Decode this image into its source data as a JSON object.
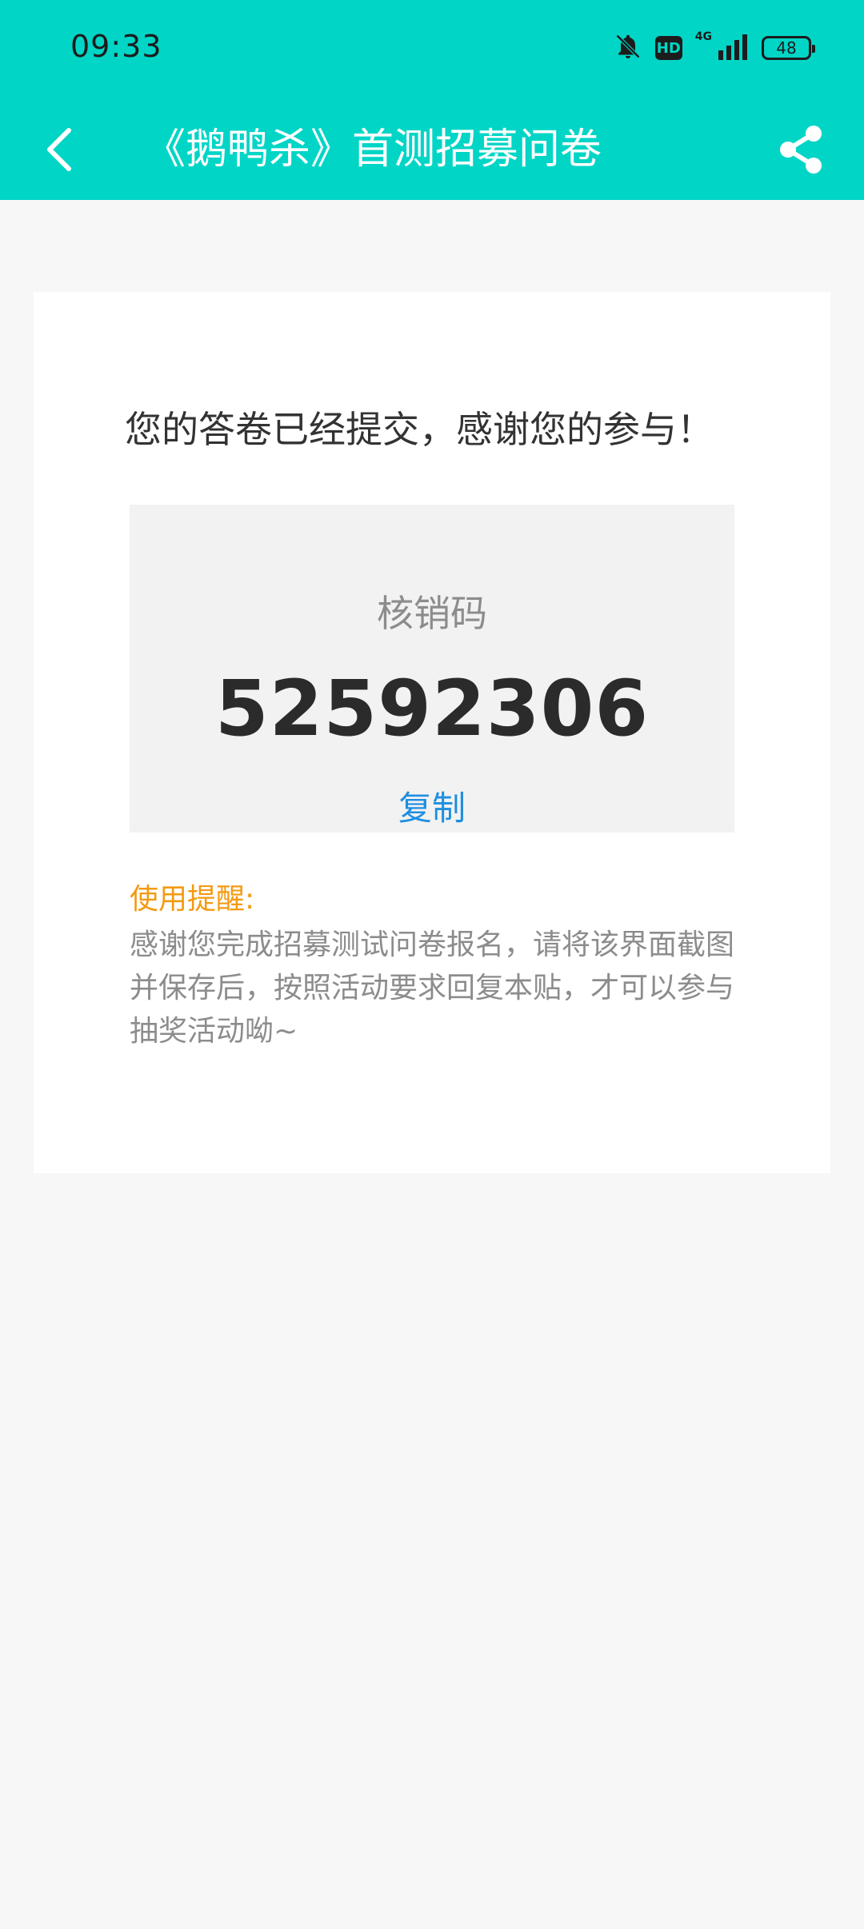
{
  "status_bar": {
    "time": "09:33",
    "hd": "HD",
    "network": "4G",
    "battery": "48",
    "icons": [
      "bell-off-icon",
      "hd-icon",
      "signal-icon",
      "battery-icon"
    ]
  },
  "nav": {
    "title": "《鹅鸭杀》首测招募问卷",
    "back_icon": "chevron-left-icon",
    "share_icon": "share-icon"
  },
  "result": {
    "message": "您的答卷已经提交，感谢您的参与！",
    "code_label": "核销码",
    "code_value": "52592306",
    "copy_label": "复制"
  },
  "tips": {
    "title": "使用提醒:",
    "body": "感谢您完成招募测试问卷报名，请将该界面截图并保存后，按照活动要求回复本贴，才可以参与抽奖活动呦~"
  },
  "colors": {
    "header": "#00d5c6",
    "accent_link": "#1e8fe0",
    "tip_title": "#f39a12",
    "page_bg": "#f7f7f7"
  }
}
